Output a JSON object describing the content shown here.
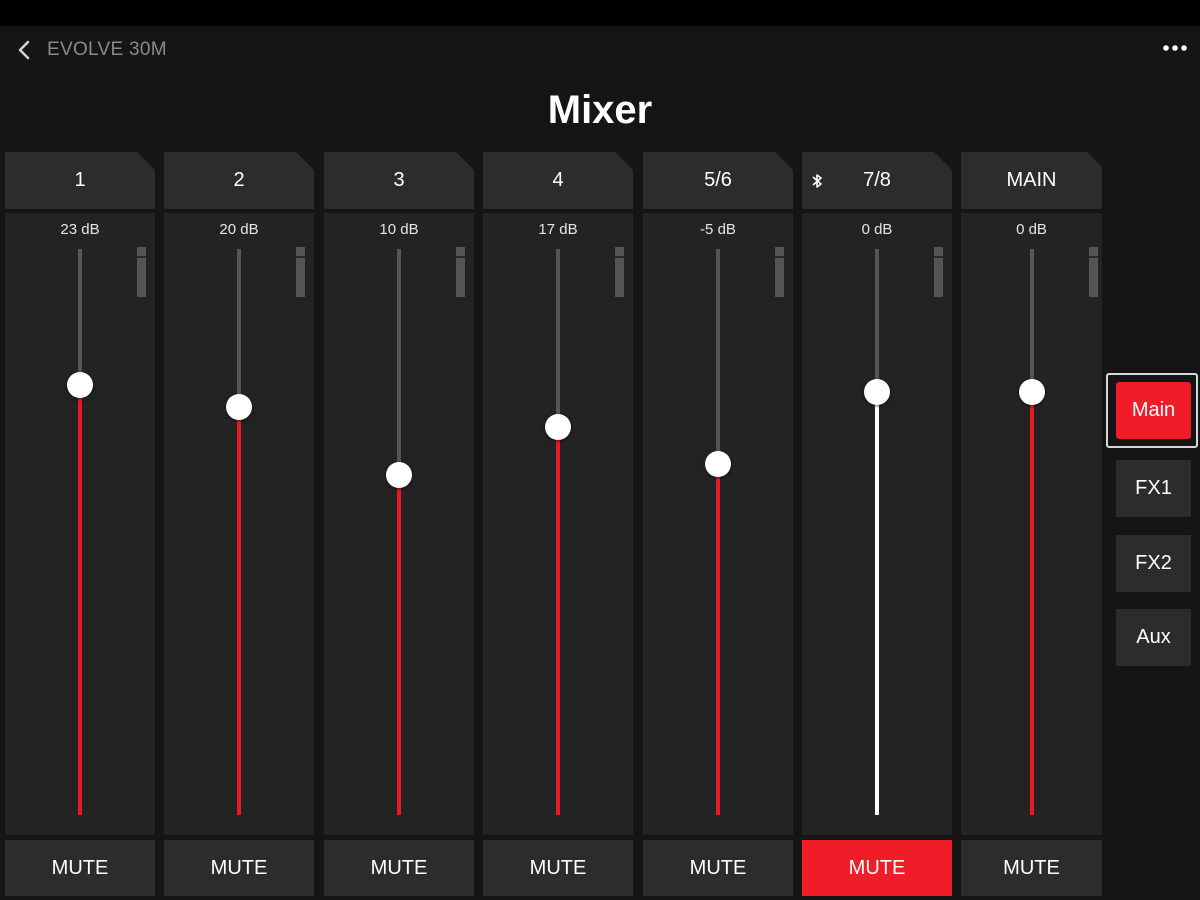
{
  "header": {
    "device_name": "EVOLVE 30M",
    "title": "Mixer"
  },
  "colors": {
    "accent": "#f01c27",
    "fader_fill": "#e51b23",
    "background": "#151515",
    "panel": "#232323",
    "button": "#2c2c2c"
  },
  "channels": [
    {
      "label": "1",
      "level": "23 dB",
      "fader_position": 0.76,
      "mute_label": "MUTE",
      "muted": false,
      "bluetooth": false
    },
    {
      "label": "2",
      "level": "20 dB",
      "fader_position": 0.72,
      "mute_label": "MUTE",
      "muted": false,
      "bluetooth": false
    },
    {
      "label": "3",
      "level": "10 dB",
      "fader_position": 0.6,
      "mute_label": "MUTE",
      "muted": false,
      "bluetooth": false
    },
    {
      "label": "4",
      "level": "17 dB",
      "fader_position": 0.685,
      "mute_label": "MUTE",
      "muted": false,
      "bluetooth": false
    },
    {
      "label": "5/6",
      "level": "-5 dB",
      "fader_position": 0.62,
      "mute_label": "MUTE",
      "muted": false,
      "bluetooth": false
    },
    {
      "label": "7/8",
      "level": "0 dB",
      "fader_position": 0.748,
      "mute_label": "MUTE",
      "muted": true,
      "bluetooth": true
    },
    {
      "label": "MAIN",
      "level": "0 dB",
      "fader_position": 0.748,
      "mute_label": "MUTE",
      "muted": false,
      "bluetooth": false
    }
  ],
  "buses": [
    {
      "label": "Main",
      "active": true
    },
    {
      "label": "FX1",
      "active": false
    },
    {
      "label": "FX2",
      "active": false
    },
    {
      "label": "Aux",
      "active": false
    }
  ]
}
